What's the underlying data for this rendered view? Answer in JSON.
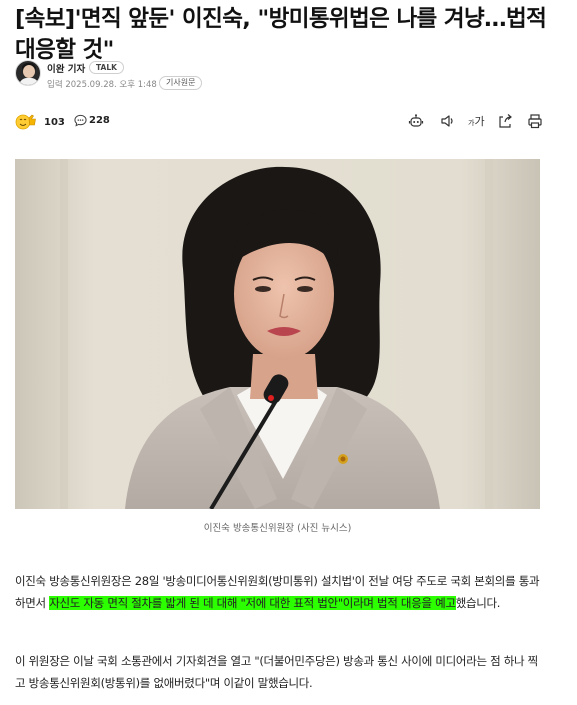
{
  "article": {
    "headline": "[속보]'면직 앞둔' 이진숙, \"방미통위법은 나를 겨냥…법적 대응할 것\"",
    "author": {
      "name": "이완 기자",
      "badge": "TALK",
      "published": "입력 2025.09.28. 오후 1:48",
      "original_link": "기사원문"
    },
    "toolbar": {
      "reaction_count": "103",
      "comment_count": "228",
      "icons": [
        "reaction-emoji-icon",
        "comment-icon",
        "summary-robot-icon",
        "audio-speaker-icon",
        "font-size-icon",
        "share-icon",
        "print-icon"
      ],
      "font_size_label_small": "가",
      "font_size_label_large": "가"
    },
    "photo_caption": "이진숙 방송통신위원장 (사진 뉴시스)",
    "paragraph1": {
      "before": "이진숙 방송통신위원장은 28일 '방송미디어통신위원회(방미통위) 설치법'이 전날 여당 주도로 국회 본회의를 통과하면서 ",
      "highlight": "자신도 자동 면직 절차를 밟게 된 데 대해 \"저에 대한 표적 법안\"이라며 법적 대응을 예고",
      "after": "했습니다."
    },
    "paragraph2": "이 위원장은 이날 국회 소통관에서 기자회견을 열고 \"(더불어민주당은) 방송과 통신 사이에 미디어라는 점 하나 찍고 방송통신위원회(방통위)를 없애버렸다\"며 이같이 말했습니다.",
    "colors": {
      "highlight": "#2bff00",
      "text": "#222222",
      "muted": "#888888"
    }
  }
}
